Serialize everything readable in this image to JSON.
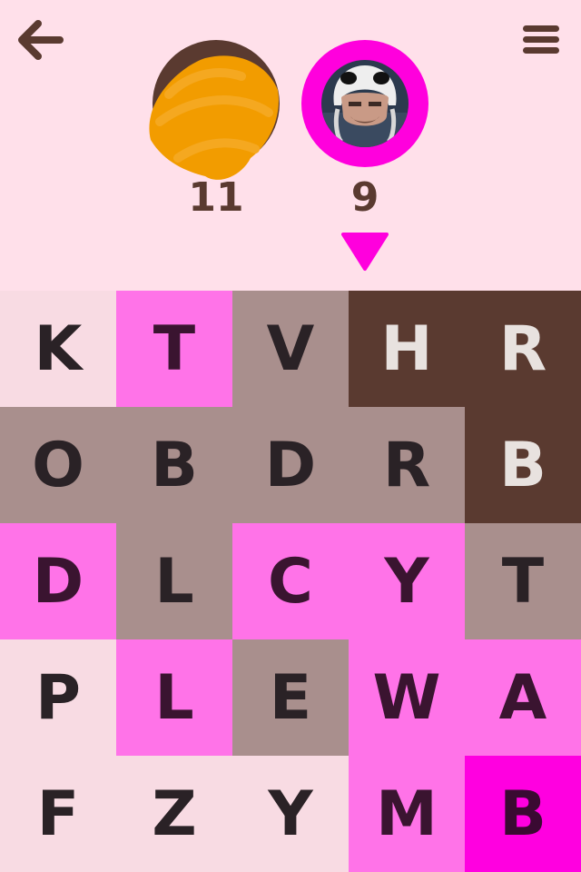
{
  "nav": {
    "back_icon": "arrow-left-icon",
    "menu_icon": "hamburger-menu-icon"
  },
  "players": [
    {
      "score": "11",
      "avatar": "scribbled-avatar",
      "color": "#5a3a30"
    },
    {
      "score": "9",
      "avatar": "photo-avatar",
      "color": "#ff00dd",
      "active": true
    }
  ],
  "colors": {
    "background": "#ffe0ea",
    "neutral": "#f8dbe3",
    "pink": "#ff73e8",
    "hotpink": "#ff00e0",
    "tan": "#a98f8d",
    "brown": "#5a3a30",
    "scribble": "#f29c00"
  },
  "board": {
    "rows": [
      [
        {
          "letter": "K",
          "color": "neutral"
        },
        {
          "letter": "T",
          "color": "pink"
        },
        {
          "letter": "V",
          "color": "tan"
        },
        {
          "letter": "H",
          "color": "brown"
        },
        {
          "letter": "R",
          "color": "brown"
        }
      ],
      [
        {
          "letter": "O",
          "color": "tan"
        },
        {
          "letter": "B",
          "color": "tan"
        },
        {
          "letter": "D",
          "color": "tan"
        },
        {
          "letter": "R",
          "color": "tan"
        },
        {
          "letter": "B",
          "color": "brown"
        }
      ],
      [
        {
          "letter": "D",
          "color": "pink"
        },
        {
          "letter": "L",
          "color": "tan"
        },
        {
          "letter": "C",
          "color": "pink"
        },
        {
          "letter": "Y",
          "color": "pink"
        },
        {
          "letter": "T",
          "color": "tan"
        }
      ],
      [
        {
          "letter": "P",
          "color": "neutral"
        },
        {
          "letter": "L",
          "color": "pink"
        },
        {
          "letter": "E",
          "color": "tan"
        },
        {
          "letter": "W",
          "color": "pink"
        },
        {
          "letter": "A",
          "color": "pink"
        }
      ],
      [
        {
          "letter": "F",
          "color": "neutral"
        },
        {
          "letter": "Z",
          "color": "neutral"
        },
        {
          "letter": "Y",
          "color": "neutral"
        },
        {
          "letter": "M",
          "color": "pink"
        },
        {
          "letter": "B",
          "color": "hotpink"
        }
      ]
    ]
  }
}
